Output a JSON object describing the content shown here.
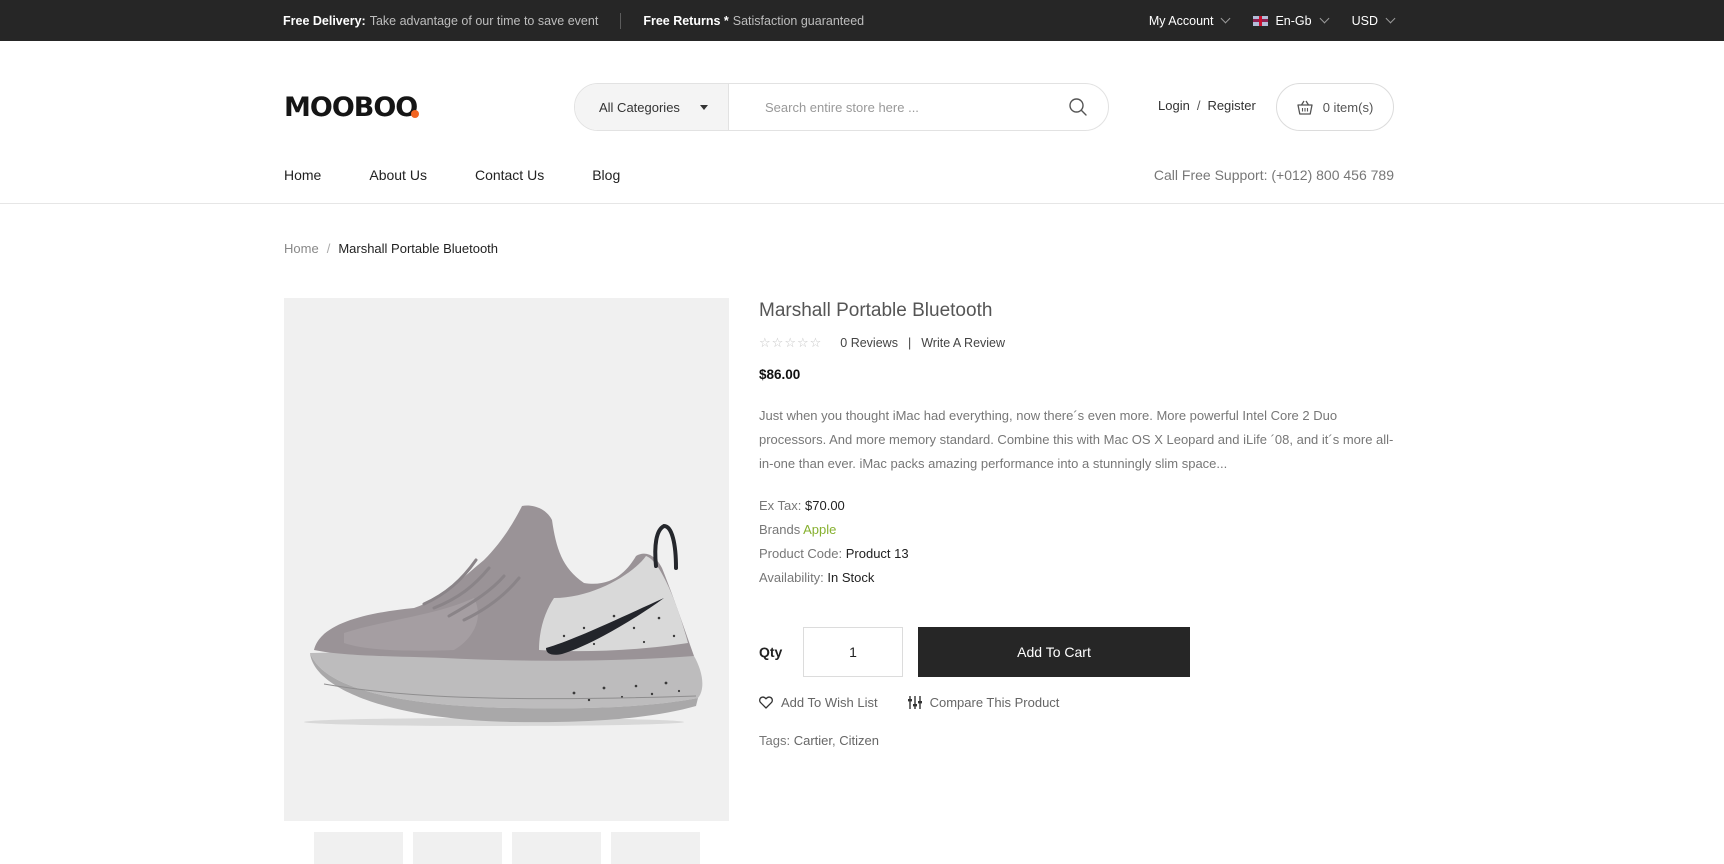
{
  "topbar": {
    "delivery_title": "Free Delivery:",
    "delivery_text": "Take advantage of our time to save event",
    "returns_title": "Free Returns *",
    "returns_text": "Satisfaction guaranteed",
    "account": "My Account",
    "language": "En-Gb",
    "currency": "USD"
  },
  "header": {
    "logo": "MOOBOO",
    "category": "All Categories",
    "search_placeholder": "Search entire store here ...",
    "login": "Login",
    "separator": "/",
    "register": "Register",
    "cart": "0 item(s)"
  },
  "nav": {
    "items": [
      "Home",
      "About Us",
      "Contact Us",
      "Blog"
    ],
    "support": "Call Free Support: (+012) 800 456 789"
  },
  "breadcrumb": {
    "home": "Home",
    "separator": "/",
    "current": "Marshall Portable Bluetooth"
  },
  "product": {
    "title": "Marshall Portable Bluetooth",
    "rating": 0,
    "reviews": "0 Reviews",
    "review_sep": "|",
    "write_review": "Write A Review",
    "price": "$86.00",
    "description": "Just when you thought iMac had everything, now there´s even more. More powerful Intel Core 2 Duo processors. And more memory standard. Combine this with Mac OS X Leopard and iLife ´08, and it´s more all-in-one than ever. iMac packs amazing performance into a stunningly slim space...",
    "ex_tax_label": "Ex Tax:",
    "ex_tax": "$70.00",
    "brands_label": "Brands",
    "brand": "Apple",
    "code_label": "Product Code:",
    "code": "Product 13",
    "availability_label": "Availability:",
    "availability": "In Stock",
    "qty_label": "Qty",
    "qty": "1",
    "add_to_cart": "Add To Cart",
    "wishlist": "Add To Wish List",
    "compare": "Compare This Product",
    "tags_label": "Tags:",
    "tag1": "Cartier",
    "tag_sep": ",",
    "tag2": "Citizen"
  },
  "colors": {
    "topbar_bg": "#262626",
    "accent_orange": "#f26522",
    "brand_link": "#86b02f"
  }
}
